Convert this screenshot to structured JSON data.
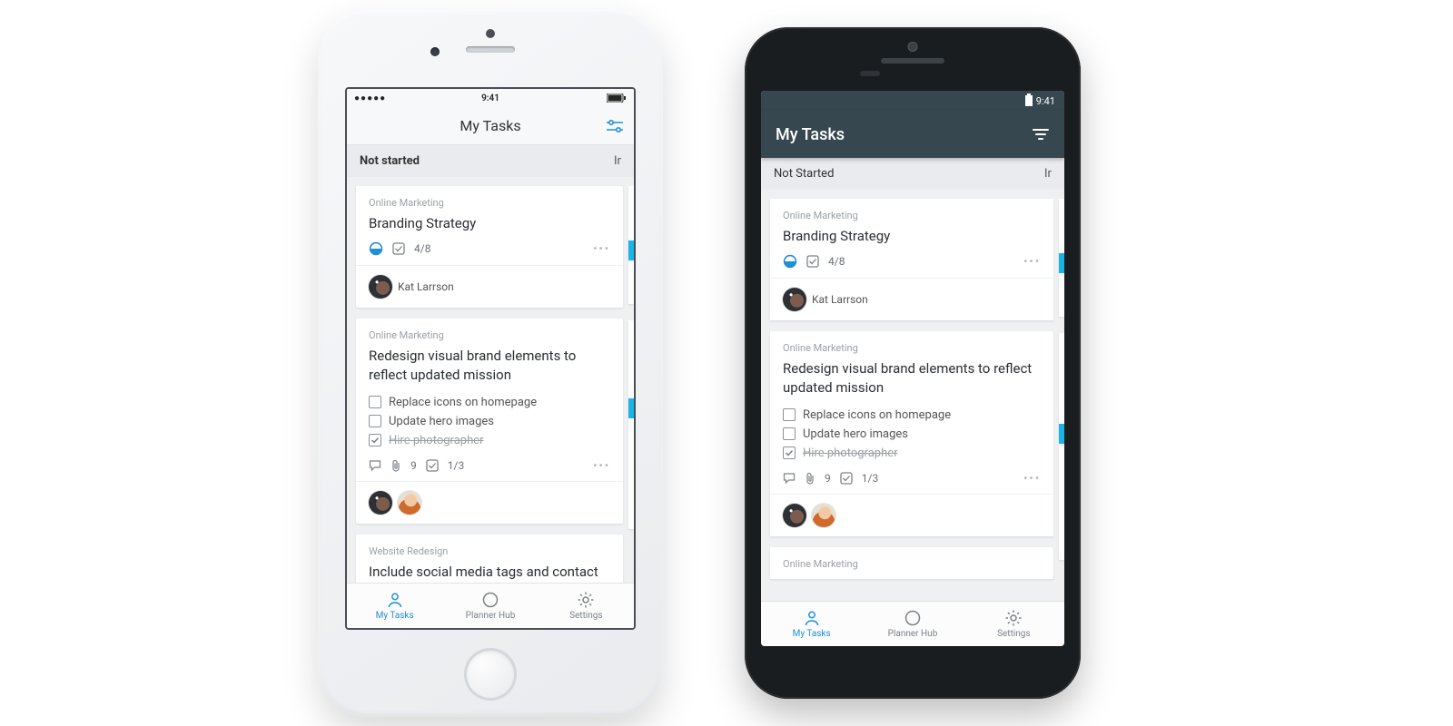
{
  "status_time": "9:41",
  "ios": {
    "title": "My Tasks",
    "column_header": "Not started",
    "column_overflow": "In",
    "tabs": {
      "mytasks": "My Tasks",
      "hub": "Planner Hub",
      "settings": "Settings"
    }
  },
  "android": {
    "title": "My Tasks",
    "column_header": "Not Started",
    "column_overflow": "In",
    "tabs": {
      "mytasks": "My Tasks",
      "hub": "Planner Hub",
      "settings": "Settings"
    }
  },
  "cards": {
    "c1": {
      "category": "Online Marketing",
      "title": "Branding Strategy",
      "checklist_count": "4/8",
      "assignee_name": "Kat Larrson"
    },
    "c2": {
      "category": "Online Marketing",
      "title": "Redesign visual brand elements to reflect updated mission",
      "subtask1": "Replace icons on homepage",
      "subtask2": "Update hero images",
      "subtask3": "Hire photographer",
      "attachments": "9",
      "checklist_count": "1/3"
    },
    "c3_ios": {
      "category": "Website Redesign",
      "title": "Include social media tags and contact sheet in the \"about\" page"
    },
    "c3_and": {
      "category": "Online Marketing"
    }
  }
}
